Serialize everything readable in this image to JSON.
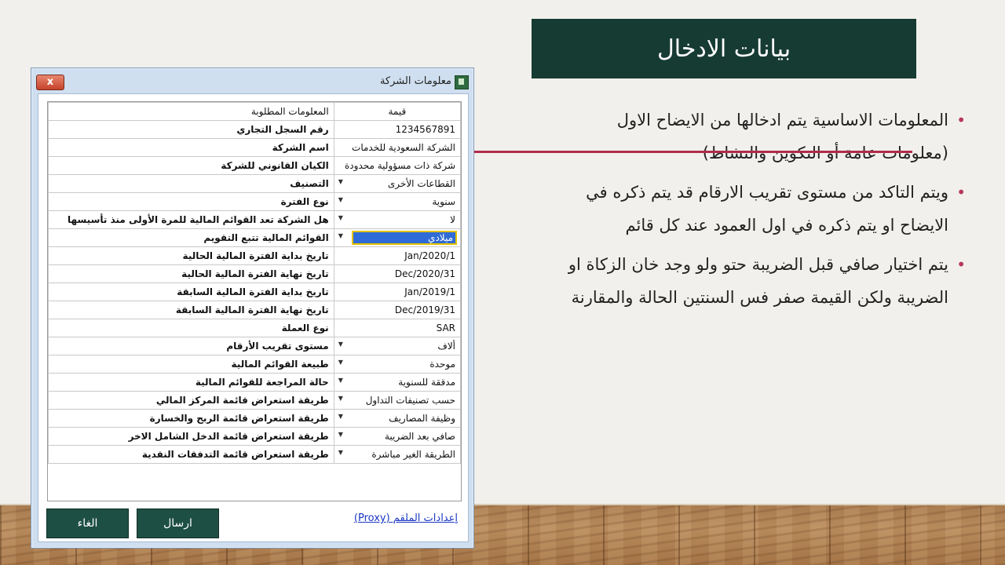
{
  "slide": {
    "title": "بيانات الادخال",
    "bullets": [
      {
        "line1": "المعلومات الاساسية يتم ادخالها من الايضاح الاول",
        "line2": "(معلومات عامة أو التكوين والنشاط)"
      },
      {
        "line1": "ويتم التاكد من مستوى تقريب الارقام قد يتم ذكره في",
        "line2": "الايضاح او يتم ذكره في اول العمود عند كل قائم"
      },
      {
        "line1": "يتم اختيار صافي قبل الضريبة حتو ولو وجد خان الزكاة او",
        "line2": "الضريبة ولكن القيمة صفر فس السنتين الحالة والمقارنة"
      }
    ],
    "colors": {
      "title_bg": "#163b33",
      "bullet": "#b7375a",
      "strike": "#b22a4c"
    }
  },
  "dialog": {
    "window_title": "معلومات الشركة",
    "close_label": "x",
    "table": {
      "header": {
        "label": "المعلومات المطلوبة",
        "value": "قيمة"
      },
      "rows": [
        {
          "label": "رقم السجل التجاري",
          "value": "1234567891",
          "dropdown": false
        },
        {
          "label": "اسم الشركة",
          "value": "الشركة السعودية للخدمات",
          "dropdown": false
        },
        {
          "label": "الكيان القانوني للشركة",
          "value": "شركة ذات مسؤولية محدودة",
          "dropdown": false
        },
        {
          "label": "التصنيف",
          "value": "القطاعات الأخرى",
          "dropdown": true
        },
        {
          "label": "نوع الفترة",
          "value": "سنوية",
          "dropdown": true
        },
        {
          "label": "هل الشركة تعد القوائم المالية للمرة الأولى منذ تأسيسها",
          "value": "لا",
          "dropdown": true
        },
        {
          "label": "القوائم المالية تتبع التقويم",
          "value": "ميلادي",
          "dropdown": true,
          "selected": true
        },
        {
          "label": "تاريخ بداية الفترة المالية الحالية",
          "value": "Jan/2020/1",
          "dropdown": false
        },
        {
          "label": "تاريخ نهاية الفترة المالية الحالية",
          "value": "Dec/2020/31",
          "dropdown": false
        },
        {
          "label": "تاريخ بداية الفترة المالية السابقة",
          "value": "Jan/2019/1",
          "dropdown": false
        },
        {
          "label": "تاريخ نهاية الفترة المالية السابقة",
          "value": "Dec/2019/31",
          "dropdown": false
        },
        {
          "label": "نوع العملة",
          "value": "SAR",
          "dropdown": false
        },
        {
          "label": "مستوى تقريب الأرقام",
          "value": "ألاف",
          "dropdown": true
        },
        {
          "label": "طبيعة القوائم المالية",
          "value": "موحدة",
          "dropdown": true
        },
        {
          "label": "حالة المراجعة للقوائم المالية",
          "value": "مدققة للسنوية",
          "dropdown": true
        },
        {
          "label": "طريقة استعراض قائمة المركز المالي",
          "value": "حسب تصنيفات التداول",
          "dropdown": true
        },
        {
          "label": "طريقة استعراض قائمة الربح والخسارة",
          "value": "وظيفة المصاريف",
          "dropdown": true
        },
        {
          "label": "طريقة استعراض قائمة الدخل الشامل الاخر",
          "value": "صافي بعد الضريبة",
          "dropdown": true
        },
        {
          "label": "طريقة استعراض قائمة التدفقات النقدية",
          "value": "الطريقة الغير مباشرة",
          "dropdown": true
        }
      ]
    },
    "buttons": {
      "cancel": "الغاء",
      "send": "ارسال"
    },
    "proxy_link": "إعدادات الملقم (Proxy)"
  }
}
